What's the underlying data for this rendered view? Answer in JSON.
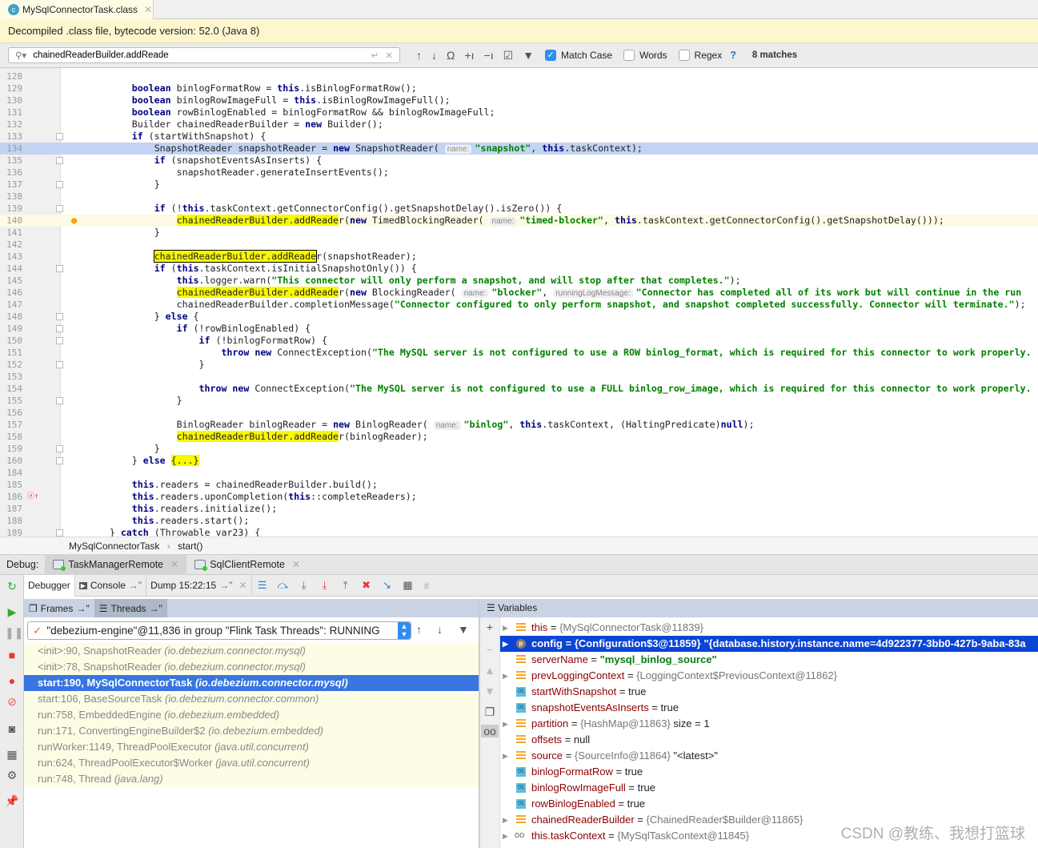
{
  "tab": {
    "label": "MySqlConnectorTask.class",
    "icon": "class-file-icon"
  },
  "banner": "Decompiled .class file, bytecode version: 52.0 (Java 8)",
  "find": {
    "value": "chainedReaderBuilder.addReade",
    "match_case": true,
    "match_case_label": "Match Case",
    "words": false,
    "words_label": "Words",
    "regex": false,
    "regex_label": "Regex",
    "help": "?",
    "matches": "8 matches"
  },
  "code": [
    {
      "n": "128",
      "i": 0,
      "t": []
    },
    {
      "n": "129",
      "i": 12,
      "t": [
        [
          "k",
          "boolean"
        ],
        [
          "",
          "binlogFormatRow = "
        ],
        [
          "k",
          "this"
        ],
        [
          "",
          ".isBinlogFormatRow();"
        ]
      ]
    },
    {
      "n": "130",
      "i": 12,
      "t": [
        [
          "k",
          "boolean"
        ],
        [
          "",
          "binlogRowImageFull = "
        ],
        [
          "k",
          "this"
        ],
        [
          "",
          ".isBinlogRowImageFull();"
        ]
      ]
    },
    {
      "n": "131",
      "i": 12,
      "t": [
        [
          "k",
          "boolean"
        ],
        [
          "",
          "rowBinlogEnabled = binlogFormatRow && binlogRowImageFull;"
        ]
      ]
    },
    {
      "n": "132",
      "i": 12,
      "t": [
        [
          "",
          "Builder chainedReaderBuilder = "
        ],
        [
          "k",
          "new"
        ],
        [
          "",
          " Builder();"
        ]
      ]
    },
    {
      "n": "133",
      "i": 12,
      "fold": true,
      "t": [
        [
          "k",
          "if"
        ],
        [
          "",
          " (startWithSnapshot) {"
        ]
      ]
    },
    {
      "n": "134",
      "i": 16,
      "exec": true,
      "t": [
        [
          "",
          "SnapshotReader snapshotReader = "
        ],
        [
          "k",
          "new"
        ],
        [
          "",
          " SnapshotReader( "
        ],
        [
          "hint",
          "name:"
        ],
        [
          "s",
          "\"snapshot\""
        ],
        [
          "",
          ", "
        ],
        [
          "k",
          "this"
        ],
        [
          "",
          ".taskContext);"
        ]
      ]
    },
    {
      "n": "135",
      "i": 16,
      "fold": true,
      "t": [
        [
          "k",
          "if"
        ],
        [
          "",
          " (snapshotEventsAsInserts) {"
        ]
      ]
    },
    {
      "n": "136",
      "i": 20,
      "t": [
        [
          "",
          "snapshotReader.generateInsertEvents();"
        ]
      ]
    },
    {
      "n": "137",
      "i": 16,
      "fold": true,
      "t": [
        [
          "",
          "}"
        ]
      ]
    },
    {
      "n": "138",
      "i": 0,
      "t": []
    },
    {
      "n": "139",
      "i": 16,
      "fold": true,
      "t": [
        [
          "k",
          "if"
        ],
        [
          "",
          " (!"
        ],
        [
          "k",
          "this"
        ],
        [
          "",
          ".taskContext.getConnectorConfig().getSnapshotDelay().isZero()) {"
        ]
      ]
    },
    {
      "n": "140",
      "i": 20,
      "caret": true,
      "bulb": true,
      "t": [
        [
          "h",
          "chainedReaderBuilder.addReade"
        ],
        [
          "",
          "r("
        ],
        [
          "k",
          "new"
        ],
        [
          "",
          " TimedBlockingReader( "
        ],
        [
          "hint",
          "name:"
        ],
        [
          "s",
          "\"timed-blocker\""
        ],
        [
          "",
          ", "
        ],
        [
          "k",
          "this"
        ],
        [
          "",
          ".taskContext.getConnectorConfig().getSnapshotDelay()));"
        ]
      ]
    },
    {
      "n": "141",
      "i": 16,
      "t": [
        [
          "",
          "}"
        ]
      ]
    },
    {
      "n": "142",
      "i": 0,
      "t": []
    },
    {
      "n": "143",
      "i": 16,
      "t": [
        [
          "hb",
          "chainedReaderBuilder.addReade"
        ],
        [
          "",
          "r(snapshotReader);"
        ]
      ]
    },
    {
      "n": "144",
      "i": 16,
      "fold": true,
      "t": [
        [
          "k",
          "if"
        ],
        [
          "",
          " ("
        ],
        [
          "k",
          "this"
        ],
        [
          "",
          ".taskContext.isInitialSnapshotOnly()) {"
        ]
      ]
    },
    {
      "n": "145",
      "i": 20,
      "t": [
        [
          "k",
          "this"
        ],
        [
          "",
          ".logger.warn("
        ],
        [
          "s",
          "\"This connector will only perform a snapshot, and will stop after that completes.\""
        ],
        [
          "",
          ");"
        ]
      ]
    },
    {
      "n": "146",
      "i": 20,
      "t": [
        [
          "h",
          "chainedReaderBuilder.addReade"
        ],
        [
          "",
          "r("
        ],
        [
          "k",
          "new"
        ],
        [
          "",
          " BlockingReader( "
        ],
        [
          "hint",
          "name:"
        ],
        [
          "s",
          "\"blocker\""
        ],
        [
          "",
          ", "
        ],
        [
          "hint",
          "runningLogMessage:"
        ],
        [
          "s",
          "\"Connector has completed all of its work but will continue in the run"
        ]
      ]
    },
    {
      "n": "147",
      "i": 20,
      "t": [
        [
          "",
          "chainedReaderBuilder.completionMessage("
        ],
        [
          "s",
          "\"Connector configured to only perform snapshot, and snapshot completed successfully. Connector will terminate.\""
        ],
        [
          "",
          ");"
        ]
      ]
    },
    {
      "n": "148",
      "i": 16,
      "fold": true,
      "t": [
        [
          "",
          "} "
        ],
        [
          "k",
          "else"
        ],
        [
          "",
          " {"
        ]
      ]
    },
    {
      "n": "149",
      "i": 20,
      "fold": true,
      "t": [
        [
          "k",
          "if"
        ],
        [
          "",
          " (!rowBinlogEnabled) {"
        ]
      ]
    },
    {
      "n": "150",
      "i": 24,
      "fold": true,
      "t": [
        [
          "k",
          "if"
        ],
        [
          "",
          " (!binlogFormatRow) {"
        ]
      ]
    },
    {
      "n": "151",
      "i": 28,
      "t": [
        [
          "k",
          "throw new"
        ],
        [
          "",
          " ConnectException("
        ],
        [
          "s",
          "\"The MySQL server is not configured to use a ROW binlog_format, which is required for this connector to work properly."
        ]
      ]
    },
    {
      "n": "152",
      "i": 24,
      "fold": true,
      "t": [
        [
          "",
          "}"
        ]
      ]
    },
    {
      "n": "153",
      "i": 0,
      "t": []
    },
    {
      "n": "154",
      "i": 24,
      "t": [
        [
          "k",
          "throw new"
        ],
        [
          "",
          " ConnectException("
        ],
        [
          "s",
          "\"The MySQL server is not configured to use a FULL binlog_row_image, which is required for this connector to work properly."
        ]
      ]
    },
    {
      "n": "155",
      "i": 20,
      "fold": true,
      "t": [
        [
          "",
          "}"
        ]
      ]
    },
    {
      "n": "156",
      "i": 0,
      "t": []
    },
    {
      "n": "157",
      "i": 20,
      "t": [
        [
          "",
          "BinlogReader binlogReader = "
        ],
        [
          "k",
          "new"
        ],
        [
          "",
          " BinlogReader( "
        ],
        [
          "hint",
          "name:"
        ],
        [
          "s",
          "\"binlog\""
        ],
        [
          "",
          ", "
        ],
        [
          "k",
          "this"
        ],
        [
          "",
          ".taskContext, (HaltingPredicate)"
        ],
        [
          "k",
          "null"
        ],
        [
          "",
          ");"
        ]
      ]
    },
    {
      "n": "158",
      "i": 20,
      "t": [
        [
          "h",
          "chainedReaderBuilder.addReade"
        ],
        [
          "",
          "r(binlogReader);"
        ]
      ]
    },
    {
      "n": "159",
      "i": 16,
      "fold": true,
      "t": [
        [
          "",
          "}"
        ]
      ]
    },
    {
      "n": "160",
      "i": 12,
      "fold": true,
      "t": [
        [
          "",
          "} "
        ],
        [
          "k",
          "else"
        ],
        [
          "",
          " "
        ],
        [
          "h",
          "{...}"
        ]
      ]
    },
    {
      "n": "184",
      "i": 0,
      "t": []
    },
    {
      "n": "185",
      "i": 12,
      "t": [
        [
          "k",
          "this"
        ],
        [
          "",
          ".readers = chainedReaderBuilder.build();"
        ]
      ]
    },
    {
      "n": "186",
      "i": 12,
      "override": true,
      "t": [
        [
          "k",
          "this"
        ],
        [
          "",
          ".readers.uponCompletion("
        ],
        [
          "k",
          "this"
        ],
        [
          "",
          "::completeReaders);"
        ]
      ]
    },
    {
      "n": "187",
      "i": 12,
      "t": [
        [
          "k",
          "this"
        ],
        [
          "",
          ".readers.initialize();"
        ]
      ]
    },
    {
      "n": "188",
      "i": 12,
      "t": [
        [
          "k",
          "this"
        ],
        [
          "",
          ".readers.start();"
        ]
      ]
    },
    {
      "n": "189",
      "i": 8,
      "fold": true,
      "t": [
        [
          "",
          "} "
        ],
        [
          "k",
          "catch"
        ],
        [
          "",
          " (Throwable var23) {"
        ]
      ]
    }
  ],
  "breadcrumb": [
    "MySqlConnectorTask",
    "start()"
  ],
  "debug": {
    "label": "Debug:",
    "sessions": [
      "TaskManagerRemote",
      "SqlClientRemote"
    ],
    "subtabs": [
      "Debugger",
      "Console",
      "Dump 15:22:15"
    ],
    "frames_tab": "Frames",
    "threads_tab": "Threads",
    "variables_title": "Variables",
    "thread": "\"debezium-engine\"@11,836 in group \"Flink Task Threads\": RUNNING"
  },
  "frames": [
    {
      "m": "<init>:90, SnapshotReader",
      "p": "(io.debezium.connector.mysql)"
    },
    {
      "m": "<init>:78, SnapshotReader",
      "p": "(io.debezium.connector.mysql)"
    },
    {
      "m": "start:190, MySqlConnectorTask",
      "p": "(io.debezium.connector.mysql)",
      "sel": true
    },
    {
      "m": "start:106, BaseSourceTask",
      "p": "(io.debezium.connector.common)"
    },
    {
      "m": "run:758, EmbeddedEngine",
      "p": "(io.debezium.embedded)"
    },
    {
      "m": "run:171, ConvertingEngineBuilder$2",
      "p": "(io.debezium.embedded)"
    },
    {
      "m": "runWorker:1149, ThreadPoolExecutor",
      "p": "(java.util.concurrent)"
    },
    {
      "m": "run:624, ThreadPoolExecutor$Worker",
      "p": "(java.util.concurrent)"
    },
    {
      "m": "run:748, Thread",
      "p": "(java.lang)"
    }
  ],
  "variables": [
    {
      "name": "this",
      "val": "{MySqlConnectorTask@11839}",
      "icon": "field",
      "exp": true
    },
    {
      "name": "config",
      "val": "{Configuration$3@11859} \"{database.history.instance.name=4d922377-3bb0-427b-9aba-83a",
      "icon": "prop",
      "exp": true,
      "sel": true
    },
    {
      "name": "serverName",
      "str": "\"mysql_binlog_source\"",
      "icon": "field"
    },
    {
      "name": "prevLoggingContext",
      "val": "{LoggingContext$PreviousContext@11862}",
      "icon": "field",
      "exp": true
    },
    {
      "name": "startWithSnapshot",
      "plain": "true",
      "icon": "bool"
    },
    {
      "name": "snapshotEventsAsInserts",
      "plain": "true",
      "icon": "bool"
    },
    {
      "name": "partition",
      "val": "{HashMap@11863}",
      "extra": "  size = 1",
      "icon": "field",
      "exp": true
    },
    {
      "name": "offsets",
      "plain": "null",
      "icon": "field"
    },
    {
      "name": "source",
      "val": "{SourceInfo@11864}",
      "extra": " \"<latest>\"",
      "icon": "field",
      "exp": true
    },
    {
      "name": "binlogFormatRow",
      "plain": "true",
      "icon": "bool"
    },
    {
      "name": "binlogRowImageFull",
      "plain": "true",
      "icon": "bool"
    },
    {
      "name": "rowBinlogEnabled",
      "plain": "true",
      "icon": "bool"
    },
    {
      "name": "chainedReaderBuilder",
      "val": "{ChainedReader$Builder@11865}",
      "icon": "field",
      "exp": true
    },
    {
      "name": "this.taskContext",
      "val": "{MySqlTaskContext@11845}",
      "icon": "watch",
      "exp": true
    }
  ],
  "watermark": "CSDN @教练、我想打篮球",
  "colors": {
    "keyword": "#000080",
    "string": "#008000",
    "search_highlight": "#f8f800",
    "exec_line": "#c3d4f2",
    "selected_frame": "#3875e0",
    "selected_var": "#0b44d6"
  }
}
